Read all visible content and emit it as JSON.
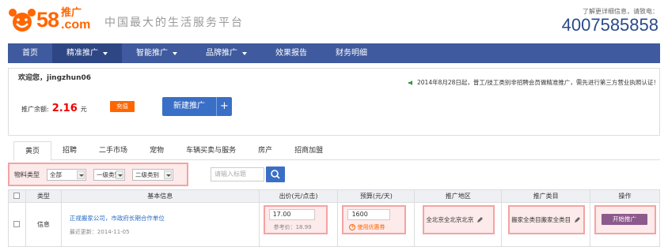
{
  "header": {
    "logo_number": "58",
    "logo_tag": "推广",
    "logo_domain": ".com",
    "slogan": "中国最大的生活服务平台",
    "hotline_note": "了解更详细信息，请致电：",
    "hotline": "4007585858"
  },
  "nav": {
    "items": [
      {
        "label": "首页",
        "caret": false,
        "active": false
      },
      {
        "label": "精准推广",
        "caret": true,
        "active": true
      },
      {
        "label": "智能推广",
        "caret": true,
        "active": false
      },
      {
        "label": "品牌推广",
        "caret": true,
        "active": false
      },
      {
        "label": "效果报告",
        "caret": false,
        "active": false
      },
      {
        "label": "财务明细",
        "caret": false,
        "active": false
      }
    ]
  },
  "account": {
    "welcome": "欢迎您，jingzhun06",
    "notice": "2014年8月28日起，普工/技工类别非招聘会员做精准推广，需先进行第三方营业执照认证！",
    "balance_label": "推广余额:",
    "balance_value": "2.16",
    "balance_unit": "元",
    "recharge_label": "充值",
    "new_promo_label": "新建推广",
    "plus": "+"
  },
  "tabs": [
    "黄页",
    "招聘",
    "二手市场",
    "宠物",
    "车辆买卖与服务",
    "房产",
    "招商加盟"
  ],
  "filter": {
    "label": "物料类型",
    "options": [
      "全部",
      "一级类别",
      "二级类别"
    ],
    "search_placeholder": "请输入标题"
  },
  "table": {
    "headers": [
      "",
      "类型",
      "基本信息",
      "出价(元/点击)",
      "预算(元/天)",
      "推广地区",
      "推广类目",
      "操作"
    ],
    "rows": [
      {
        "type": "信息",
        "title": "正规搬家公司，市政府长期合作单位",
        "updated": "最近更新：2014-11-05",
        "bid": "17.00",
        "ref_price": "参考价：18.99",
        "budget": "1600",
        "coupon": "使用优惠券",
        "region": "全北京全北京北京",
        "category": "搬家全类目搬家全类目",
        "action": "开始推广"
      }
    ]
  },
  "colors": {
    "brand": "#ff6600",
    "nav": "#3f5a9e",
    "highlight": "#f4a3a3",
    "primary_button": "#3a6fc7"
  }
}
